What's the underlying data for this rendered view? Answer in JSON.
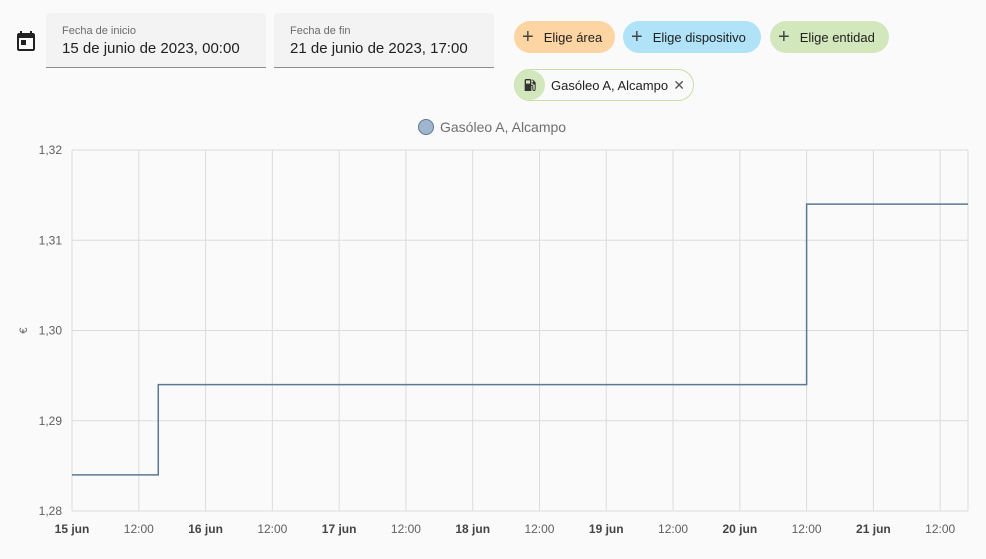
{
  "date_range": {
    "start_label": "Fecha de inicio",
    "start_value": "15 de junio de 2023, 00:00",
    "end_label": "Fecha de fin",
    "end_value": "21 de junio de 2023, 17:00"
  },
  "chips": {
    "area": "Elige área",
    "device": "Elige dispositivo",
    "entity": "Elige entidad"
  },
  "selected_entity": {
    "name": "Gasóleo A, Alcampo",
    "icon": "gas-station-icon"
  },
  "colors": {
    "line": "#5b7894",
    "area_chip": "#fdd5a2",
    "device_chip": "#b0e2f8",
    "entity_chip": "#d3e7bd"
  },
  "chart_data": {
    "type": "line",
    "step": true,
    "legend": [
      "Gasóleo A, Alcampo"
    ],
    "ylabel": "€",
    "ylim": [
      1.28,
      1.32
    ],
    "yticks": [
      "1,32",
      "1,31",
      "1,30",
      "1,29",
      "1,28"
    ],
    "xrange_hours": [
      0,
      161
    ],
    "xticks": [
      {
        "label": "15 jun",
        "bold": true
      },
      {
        "label": "12:00",
        "bold": false
      },
      {
        "label": "16 jun",
        "bold": true
      },
      {
        "label": "12:00",
        "bold": false
      },
      {
        "label": "17 jun",
        "bold": true
      },
      {
        "label": "12:00",
        "bold": false
      },
      {
        "label": "18 jun",
        "bold": true
      },
      {
        "label": "12:00",
        "bold": false
      },
      {
        "label": "19 jun",
        "bold": true
      },
      {
        "label": "12:00",
        "bold": false
      },
      {
        "label": "20 jun",
        "bold": true
      },
      {
        "label": "12:00",
        "bold": false
      },
      {
        "label": "21 jun",
        "bold": true
      },
      {
        "label": "12:00",
        "bold": false
      }
    ],
    "series": [
      {
        "name": "Gasóleo A, Alcampo",
        "x_hours": [
          0,
          15.5,
          132,
          161
        ],
        "values": [
          1.284,
          1.294,
          1.314,
          1.314
        ]
      }
    ]
  }
}
